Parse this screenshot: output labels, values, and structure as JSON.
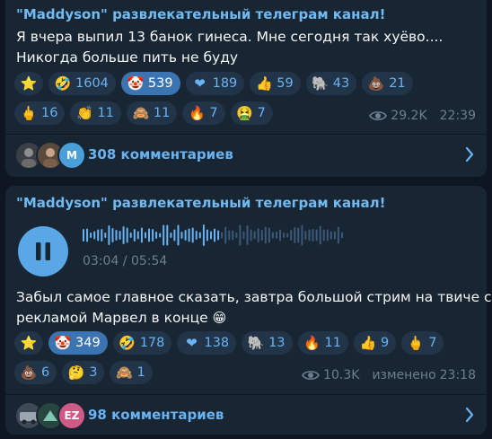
{
  "posts": [
    {
      "channel": "\"Maddyson\" развлекательный телеграм канал!",
      "lines": [
        "Я вчера выпил 13 банок гинеса. Мне сегодня так хуёво....",
        "Никогда больше пить не буду"
      ],
      "reactions": [
        [
          {
            "emoji": "⭐",
            "count": "",
            "selected": false,
            "name": "star"
          },
          {
            "emoji": "🤣",
            "count": "1604",
            "selected": false,
            "name": "rofl"
          },
          {
            "emoji": "🤡",
            "count": "539",
            "selected": true,
            "name": "clown"
          },
          {
            "emoji": "❤",
            "count": "189",
            "selected": false,
            "name": "heart"
          },
          {
            "emoji": "👍",
            "count": "59",
            "selected": false,
            "name": "thumbs-up"
          },
          {
            "emoji": "🐘",
            "count": "43",
            "selected": false,
            "name": "elephant"
          },
          {
            "emoji": "💩",
            "count": "21",
            "selected": false,
            "name": "poop"
          }
        ],
        [
          {
            "emoji": "🖕",
            "count": "16",
            "selected": false,
            "name": "middle-finger"
          },
          {
            "emoji": "👏",
            "count": "11",
            "selected": false,
            "name": "clap"
          },
          {
            "emoji": "🙈",
            "count": "11",
            "selected": false,
            "name": "see-no-evil"
          },
          {
            "emoji": "🔥",
            "count": "7",
            "selected": false,
            "name": "fire"
          },
          {
            "emoji": "🤮",
            "count": "7",
            "selected": false,
            "name": "vomit"
          }
        ]
      ],
      "views": "29.2K",
      "time": "22:39",
      "comments": "308 комментариев",
      "avatar_letters": [
        "",
        "",
        "M"
      ]
    },
    {
      "channel": "\"Maddyson\" развлекательный телеграм канал!",
      "voice": {
        "duration": "03:04 / 05:54",
        "progress": 0.52
      },
      "lines": [
        "Забыл самое главное сказать, завтра большой стрим на твиче с",
        "рекламой Марвел в конце"
      ],
      "reactions": [
        [
          {
            "emoji": "⭐",
            "count": "",
            "selected": false,
            "name": "star"
          },
          {
            "emoji": "🤡",
            "count": "349",
            "selected": true,
            "name": "clown"
          },
          {
            "emoji": "🤣",
            "count": "178",
            "selected": false,
            "name": "rofl"
          },
          {
            "emoji": "❤",
            "count": "138",
            "selected": false,
            "name": "heart"
          },
          {
            "emoji": "🐘",
            "count": "13",
            "selected": false,
            "name": "elephant"
          },
          {
            "emoji": "🔥",
            "count": "11",
            "selected": false,
            "name": "fire"
          },
          {
            "emoji": "👍",
            "count": "9",
            "selected": false,
            "name": "thumbs-up"
          },
          {
            "emoji": "🖕",
            "count": "7",
            "selected": false,
            "name": "middle-finger"
          }
        ],
        [
          {
            "emoji": "💩",
            "count": "6",
            "selected": false,
            "name": "poop"
          },
          {
            "emoji": "🤔",
            "count": "3",
            "selected": false,
            "name": "thinking"
          },
          {
            "emoji": "🙈",
            "count": "1",
            "selected": false,
            "name": "see-no-evil"
          }
        ]
      ],
      "views": "10.3K",
      "edited": "изменено",
      "time": "23:18",
      "comments": "98 комментариев",
      "avatar_letters": [
        "",
        "",
        "EZ"
      ]
    }
  ],
  "colors": {
    "bg": "#0e1621",
    "bubble": "#182533",
    "accent": "#6ab3f3",
    "channel": "#71baf2",
    "selected": "#3b74b0",
    "meta": "#6d7f8f"
  }
}
